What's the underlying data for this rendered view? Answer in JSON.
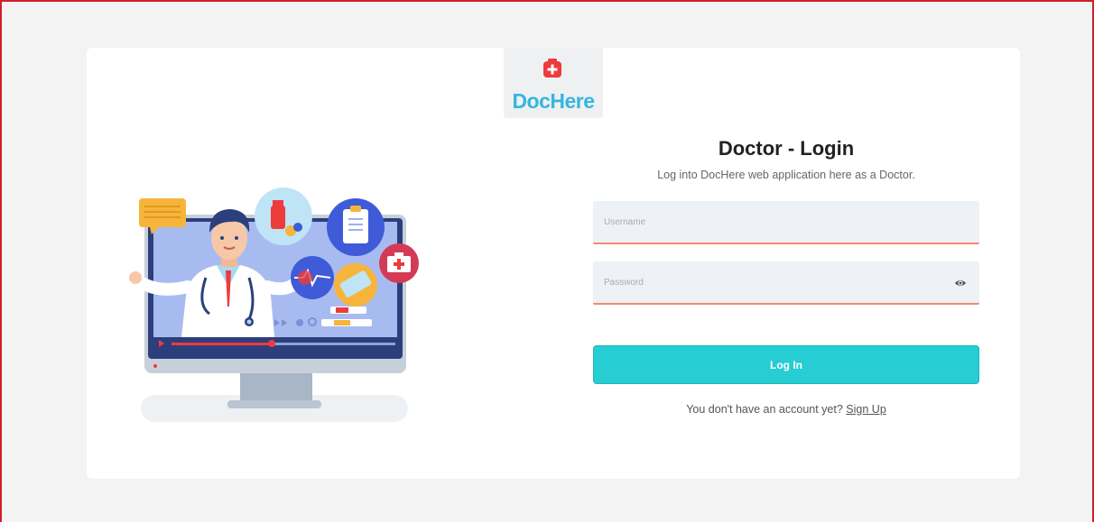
{
  "brand": {
    "name": "DocHere",
    "primary_color": "#36b6dd",
    "accent_color": "#ee3b3b"
  },
  "login": {
    "title": "Doctor - Login",
    "subtitle": "Log into DocHere web application here as a Doctor.",
    "username_placeholder": "Username",
    "password_placeholder": "Password",
    "button_label": "Log In",
    "signup_prompt": "You don't have an account yet?",
    "signup_link": "Sign Up"
  },
  "colors": {
    "button": "#26cdd2",
    "input_underline": "#f08a6d",
    "frame_border": "#d11f2a"
  },
  "icons": {
    "logo": "medical-cross-icon",
    "password_toggle": "eye-icon",
    "illustration": "doctor-illustration"
  }
}
